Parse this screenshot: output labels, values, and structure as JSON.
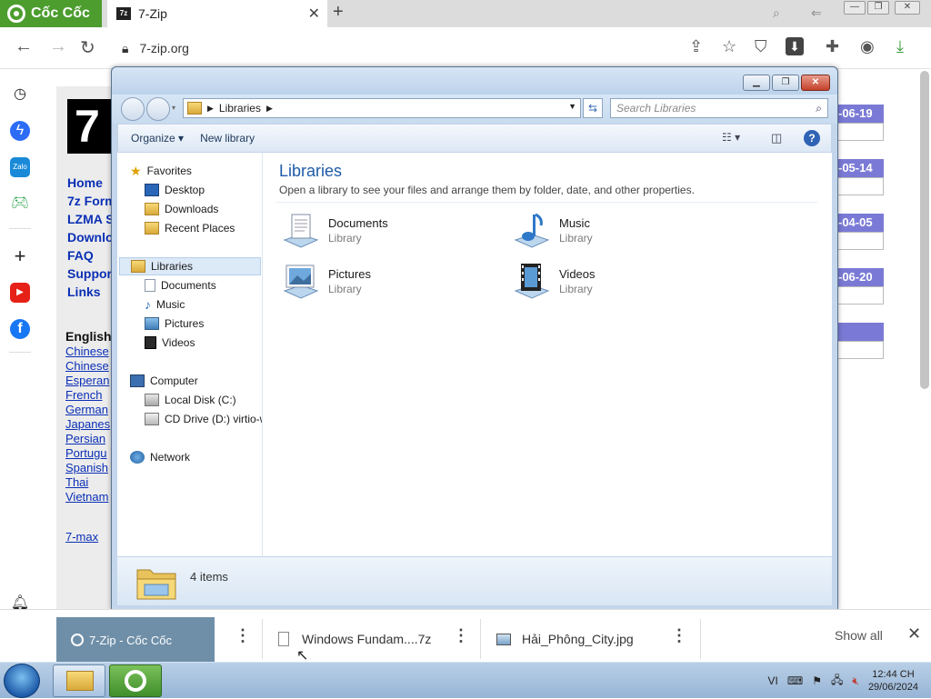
{
  "browser": {
    "brand": "Cốc Cốc",
    "tab_title": "7-Zip",
    "tab_favicon_text": "7z",
    "url": "7-zip.org"
  },
  "page": {
    "logo_char": "7",
    "nav_links": [
      "Home",
      "7z Form",
      "LZMA S",
      "Downlo",
      "FAQ",
      "Suppor",
      "Links"
    ],
    "lang_heading": "English",
    "languages": [
      "Chinese",
      "Chinese",
      "Esperan",
      "French",
      "German",
      "Japanes",
      "Persian",
      "Portugu",
      "Spanish",
      "Thai",
      "Vietnam"
    ],
    "footer_link": "7-max",
    "dates": [
      "-06-19",
      "-05-14",
      "-04-05",
      "-06-20"
    ]
  },
  "explorer": {
    "address": "Libraries",
    "search_placeholder": "Search Libraries",
    "toolbar": {
      "organize": "Organize",
      "new_library": "New library"
    },
    "nav": {
      "favorites": "Favorites",
      "favorites_items": [
        "Desktop",
        "Downloads",
        "Recent Places"
      ],
      "libraries": "Libraries",
      "library_items": [
        "Documents",
        "Music",
        "Pictures",
        "Videos"
      ],
      "computer": "Computer",
      "computer_items": [
        "Local Disk (C:)",
        "CD Drive (D:) virtio-w"
      ],
      "network": "Network"
    },
    "content": {
      "title": "Libraries",
      "description": "Open a library to see your files and arrange them by folder, date, and other properties.",
      "items": [
        {
          "name": "Documents",
          "type": "Library"
        },
        {
          "name": "Music",
          "type": "Library"
        },
        {
          "name": "Pictures",
          "type": "Library"
        },
        {
          "name": "Videos",
          "type": "Library"
        }
      ]
    },
    "status": "4 items"
  },
  "downloads": {
    "items": [
      "7-Zip - Cốc Cốc",
      "Windows Fundam....7z",
      "Hải_Phông_City.jpg"
    ],
    "show_all": "Show all"
  },
  "taskbar": {
    "lang": "VI",
    "time": "12:44 CH",
    "date": "29/06/2024"
  },
  "colors": {
    "brand_green": "#4c9d2e",
    "link_blue": "#0a2fb5",
    "date_purple": "#7a7ad6",
    "explorer_frame": "#c3d6ec"
  }
}
